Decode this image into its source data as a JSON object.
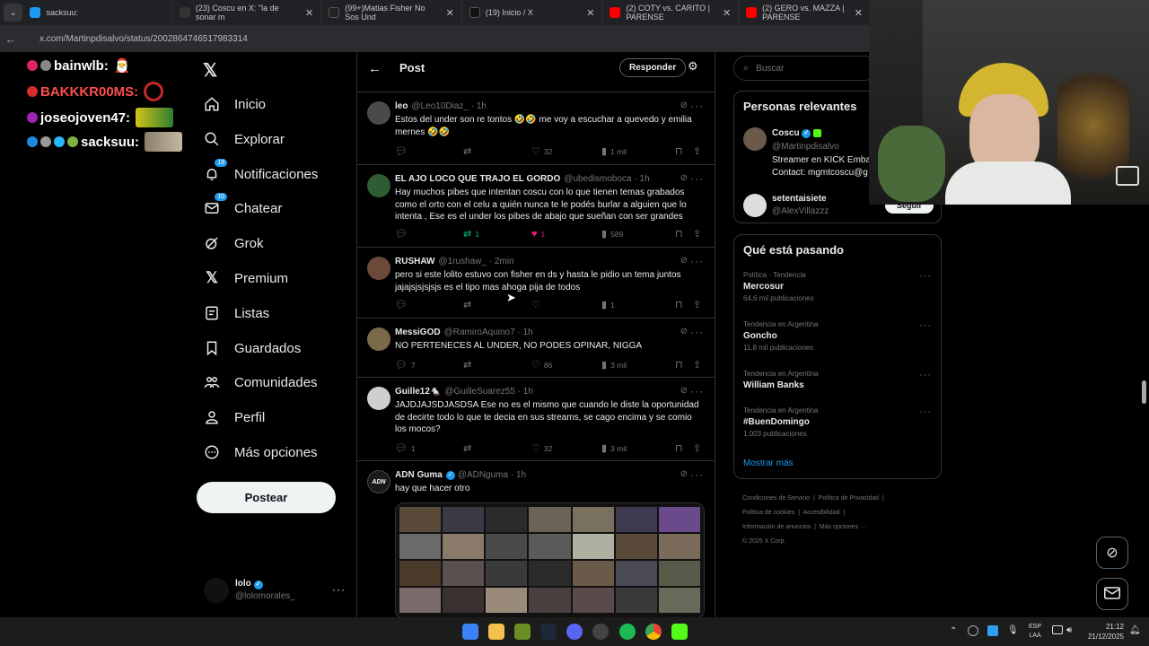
{
  "browser": {
    "tabs": [
      {
        "label": "sacksuu:",
        "icon": "x-icon"
      },
      {
        "label": "(23) Coscu en X: \"la de sonar m",
        "icon": "x-icon"
      },
      {
        "label": "(99+)Matias Fisher No Sos Und",
        "icon": "tiktok-icon"
      },
      {
        "label": "(19) Inicio / X",
        "icon": "x-icon"
      },
      {
        "label": "(2) COTY vs. CARITO | PARENSE",
        "icon": "youtube-icon"
      },
      {
        "label": "(2) GERO vs. MAZZA | PARENSE",
        "icon": "youtube-icon"
      }
    ],
    "url": "x.com/Martinpdisalvo/status/2002864746517983314"
  },
  "stream_chat": [
    {
      "user": "bainwlb:"
    },
    {
      "user": "BAKKKR00MS:"
    },
    {
      "user": "joseojoven47:"
    },
    {
      "user": "sacksuu:"
    }
  ],
  "nav": {
    "items": [
      {
        "label": "Inicio",
        "icon": "home-icon"
      },
      {
        "label": "Explorar",
        "icon": "search-icon"
      },
      {
        "label": "Notificaciones",
        "icon": "bell-icon",
        "badge": "19"
      },
      {
        "label": "Chatear",
        "icon": "mail-icon",
        "badge": "10"
      },
      {
        "label": "Grok",
        "icon": "grok-icon"
      },
      {
        "label": "Premium",
        "icon": "x-icon"
      },
      {
        "label": "Listas",
        "icon": "list-icon"
      },
      {
        "label": "Guardados",
        "icon": "bookmark-icon"
      },
      {
        "label": "Comunidades",
        "icon": "communities-icon"
      },
      {
        "label": "Perfil",
        "icon": "person-icon"
      },
      {
        "label": "Más opciones",
        "icon": "more-icon"
      }
    ],
    "post_button": "Postear",
    "account": {
      "name": "lolo",
      "handle": "@lolomorales_"
    }
  },
  "header": {
    "title": "Post",
    "reply_button": "Responder"
  },
  "tweets": [
    {
      "name": "leo",
      "handle": "@Leo10Diaz_ · 1h",
      "text": "Estos del under son re tontos 🤣🤣 me voy a escuchar a quevedo y emilia mernes 🤣🤣",
      "replies": "",
      "retweets": "",
      "likes": "32",
      "views": "1 mil"
    },
    {
      "name": "EL AJO LOCO QUE TRAJO EL GORDO",
      "handle": "@ubedismoboca · 1h",
      "text": "Hay muchos pibes que intentan coscu con lo que tienen temas grabados como el orto con el celu a quién nunca te le podés burlar a alguien que lo intenta , Ese es el under los pibes de abajo que sueñan con ser grandes",
      "replies": "",
      "retweets": "1",
      "likes": "1",
      "views": "589"
    },
    {
      "name": "RUSHAW",
      "handle": "@1rushaw_ · 2min",
      "text": "pero si este lolito estuvo con fisher en ds y hasta le pidio un tema juntos jajajsjsjsjsjs es el tipo mas ahoga pija de todos",
      "replies": "",
      "retweets": "",
      "likes": "",
      "views": "1"
    },
    {
      "name": "MessiGOD",
      "handle": "@RamiroAquino7 · 1h",
      "text": "NO PERTENECES AL UNDER, NO PODES OPINAR, NIGGA",
      "replies": "7",
      "retweets": "",
      "likes": "86",
      "views": "3 mil"
    },
    {
      "name": "Guille12🐁",
      "handle": "@GuilleSuarez55 · 1h",
      "text": "JAJDJAJSDJASDSA Ese no es el mismo que cuando le diste la oportunidad de decirte todo lo que te decia en sus streams, se cago encima y se comio los mocos?",
      "replies": "1",
      "retweets": "",
      "likes": "32",
      "views": "3 mil"
    },
    {
      "name": "ADN Guma",
      "handle": "@ADNguma · 1h",
      "text": "hay que hacer otro",
      "replies": "",
      "retweets": "",
      "likes": "",
      "views": ""
    }
  ],
  "right": {
    "search_placeholder": "Buscar",
    "relevant_title": "Personas relevantes",
    "people": [
      {
        "name": "Coscu",
        "handle": "@Martinpdisalvo",
        "bio": "Streamer en KICK Emba",
        "bio2": "Contact: mgmtcoscu@g"
      },
      {
        "name": "setentaisiete",
        "handle": "@AlexVillazzz",
        "follow": "Seguir"
      }
    ],
    "trending_title": "Qué está pasando",
    "trends": [
      {
        "category": "Política · Tendencia",
        "topic": "Mercosur",
        "count": "64,6 mil publicaciones"
      },
      {
        "category": "Tendencia en Argentina",
        "topic": "Goncho",
        "count": "11,8 mil publicaciones"
      },
      {
        "category": "Tendencia en Argentina",
        "topic": "William Banks",
        "count": ""
      },
      {
        "category": "Tendencia en Argentina",
        "topic": "#BuenDomingo",
        "count": "1.003 publicaciones"
      }
    ],
    "show_more": "Mostrar más",
    "footer": [
      "Condiciones de Servicio",
      "Política de Privacidad",
      "Política de cookies",
      "Accesibilidad",
      "Información de anuncios",
      "Más opciones ···",
      "© 2025 X Corp."
    ]
  },
  "taskbar": {
    "lang1": "ESP",
    "lang2": "LAA",
    "time": "21:12",
    "date": "21/12/2025"
  },
  "colors": {
    "accent": "#1d9bf0",
    "like_active": "#f91880",
    "retweet_active": "#00ba7c"
  }
}
